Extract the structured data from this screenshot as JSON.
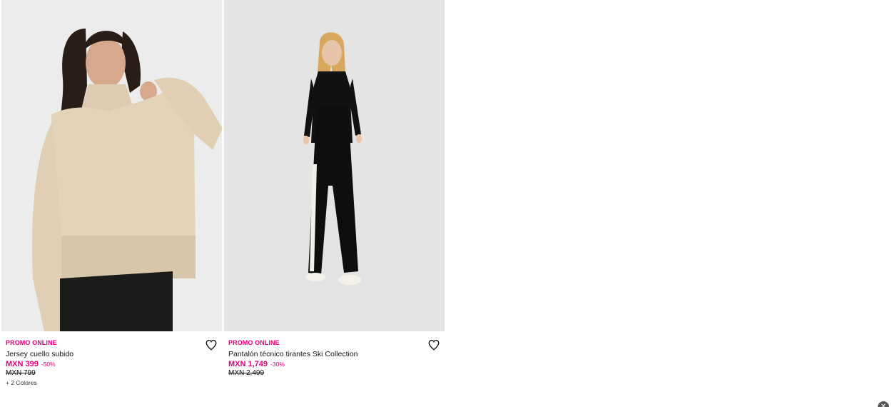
{
  "products": [
    {
      "promo": "PROMO ONLINE",
      "name": "Jersey cuello subido",
      "price": "MXN 399",
      "discount": "-50%",
      "old_price": "MXN 799",
      "colors": "+ 2 Colores",
      "image_icon": "sweater-photo"
    },
    {
      "promo": "PROMO ONLINE",
      "name": "Pantalón técnico tirantes Ski Collection",
      "price": "MXN 1,749",
      "discount": "-30%",
      "old_price": "MXN 2,499",
      "image_icon": "ski-pants-photo"
    }
  ],
  "icons": {
    "wishlist": "heart-outline-icon",
    "close": "close-icon"
  },
  "colors": {
    "accent": "#e4007c",
    "text": "#111111",
    "photo_bg": "#e6e6e6"
  }
}
